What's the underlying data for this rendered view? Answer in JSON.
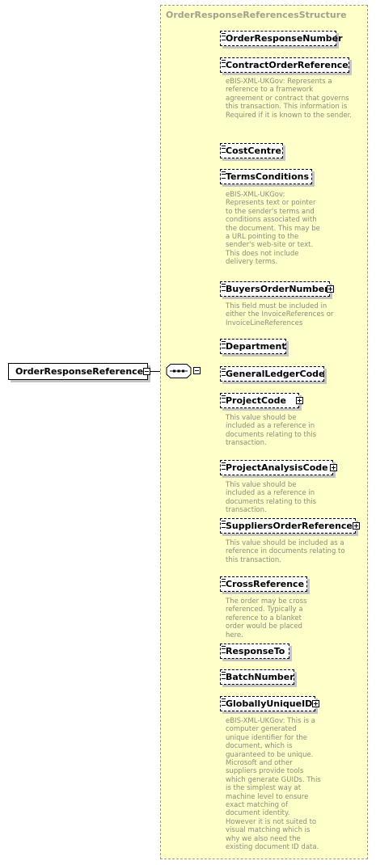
{
  "root_element": "OrderResponseReferences",
  "type_name": "OrderResponseReferencesStructure",
  "children": [
    {
      "name": "OrderResponseNumber",
      "expandable": false,
      "doc": ""
    },
    {
      "name": "ContractOrderReference",
      "expandable": false,
      "doc": "eBIS-XML-UKGov: Represents a reference to a framework agreement or contract that governs this transaction. This information is Required if it is known to the sender."
    },
    {
      "name": "CostCentre",
      "expandable": false,
      "doc": ""
    },
    {
      "name": "TermsConditions",
      "expandable": false,
      "doc": "eBIS-XML-UKGov: Represents text or pointer to the sender's terms and conditions associated with the document. This may be a URL pointing to the sender's web-site or text. This does not include delivery terms."
    },
    {
      "name": "BuyersOrderNumber",
      "expandable": true,
      "doc": "This field must be included in either the InvoiceReferences or InvoiceLineReferences"
    },
    {
      "name": "Department",
      "expandable": false,
      "doc": ""
    },
    {
      "name": "GeneralLedgerCode",
      "expandable": false,
      "doc": ""
    },
    {
      "name": "ProjectCode",
      "expandable": true,
      "doc": "This value should be included as a reference in documents relating to this transaction."
    },
    {
      "name": "ProjectAnalysisCode",
      "expandable": true,
      "doc": "This value should be included as a reference in documents relating to this transaction."
    },
    {
      "name": "SuppliersOrderReference",
      "expandable": true,
      "doc": "This value should be included as a reference in documents relating to this transaction."
    },
    {
      "name": "CrossReference",
      "expandable": false,
      "doc": "The order may be cross referenced. Typically a reference to a blanket order would be placed here."
    },
    {
      "name": "ResponseTo",
      "expandable": false,
      "doc": ""
    },
    {
      "name": "BatchNumber",
      "expandable": false,
      "doc": ""
    },
    {
      "name": "GloballyUniqueID",
      "expandable": true,
      "doc": "eBIS-XML-UKGov: This is a computer generated unique identifier for the document, which is guaranteed to be unique. Microsoft and other suppliers provide tools which generate GUIDs. This is the simplest way at machine level to ensure exact matching of document identity. However it is not suited to visual matching which is why we also need the existing document ID data."
    }
  ]
}
